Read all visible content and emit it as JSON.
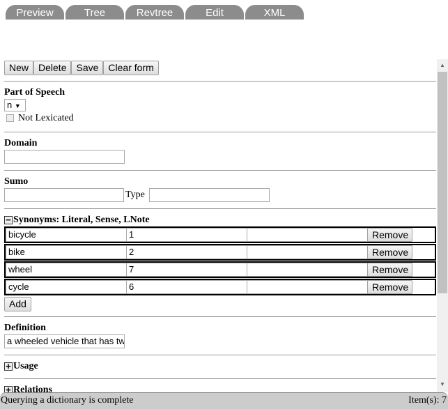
{
  "tabs": [
    "Preview",
    "Tree",
    "Revtree",
    "Edit",
    "XML"
  ],
  "toolbar": {
    "new": "New",
    "delete": "Delete",
    "save": "Save",
    "clear": "Clear form"
  },
  "pos": {
    "label": "Part of Speech",
    "value": "n",
    "not_lexicated": "Not Lexicated",
    "not_lexicated_checked": false
  },
  "domain": {
    "label": "Domain",
    "value": ""
  },
  "sumo": {
    "label": "Sumo",
    "value": "",
    "type_label": "Type",
    "type_value": ""
  },
  "synonyms": {
    "label": "Synonyms: Literal, Sense, LNote",
    "remove": "Remove",
    "add": "Add",
    "rows": [
      {
        "literal": "bicycle",
        "sense": "1",
        "lnote": ""
      },
      {
        "literal": "bike",
        "sense": "2",
        "lnote": ""
      },
      {
        "literal": "wheel",
        "sense": "7",
        "lnote": ""
      },
      {
        "literal": "cycle",
        "sense": "6",
        "lnote": ""
      }
    ]
  },
  "definition": {
    "label": "Definition",
    "value": "a wheeled vehicle that has tw"
  },
  "usage": {
    "label": "Usage"
  },
  "relations": {
    "label": "Relations"
  },
  "status": {
    "message": "Querying a dictionary is complete",
    "items": "Item(s): 7"
  }
}
